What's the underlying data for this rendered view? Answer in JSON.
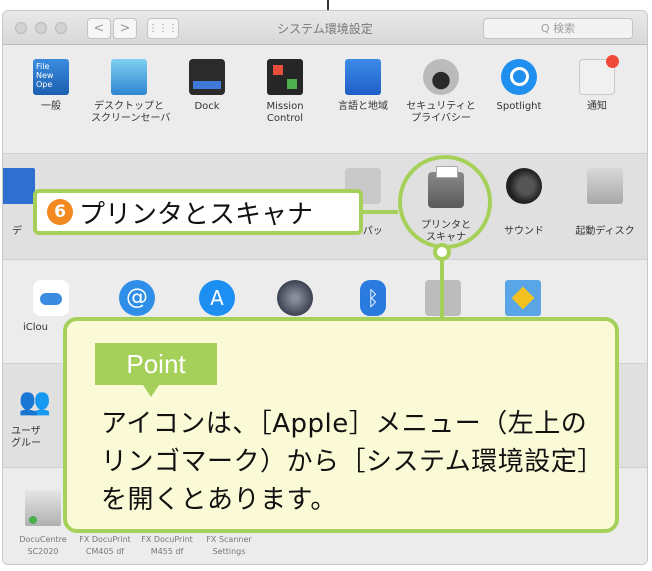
{
  "window": {
    "title": "システム環境設定",
    "search_placeholder": "Q 検索",
    "nav_back": "<",
    "nav_forward": ">",
    "grid_button": "⋮⋮⋮"
  },
  "row1": [
    {
      "label": "一般",
      "icon": "general-icon"
    },
    {
      "label": "デスクトップと\nスクリーンセーバ",
      "icon": "desktop-icon"
    },
    {
      "label": "Dock",
      "icon": "dock-icon"
    },
    {
      "label": "Mission\nControl",
      "icon": "mission-control-icon"
    },
    {
      "label": "言語と地域",
      "icon": "language-region-icon"
    },
    {
      "label": "セキュリティと\nプライバシー",
      "icon": "security-privacy-icon"
    },
    {
      "label": "Spotlight",
      "icon": "spotlight-icon"
    },
    {
      "label": "通知",
      "icon": "notifications-icon"
    }
  ],
  "row2": [
    {
      "label": "デ",
      "icon": "displays-icon"
    },
    {
      "label": "ックパッ",
      "icon": "trackpad-icon"
    },
    {
      "label": "プリンタと\nスキャナ",
      "icon": "printer-icon"
    },
    {
      "label": "サウンド",
      "icon": "sound-icon"
    },
    {
      "label": "起動ディスク",
      "icon": "startup-disk-icon"
    }
  ],
  "row3": [
    {
      "label": "iClou",
      "icon": "icloud-icon"
    },
    {
      "label": "",
      "icon": "internet-accounts-icon"
    },
    {
      "label": "",
      "icon": "app-store-icon"
    },
    {
      "label": "",
      "icon": "network-icon"
    },
    {
      "label": "",
      "icon": "bluetooth-icon"
    },
    {
      "label": "",
      "icon": "extensions-icon"
    },
    {
      "label": "",
      "icon": "sharing-icon"
    }
  ],
  "row4": [
    {
      "label": "ユーザ\nグルー",
      "icon": "users-groups-icon"
    }
  ],
  "row5_bottom": [
    "DocuCentre SC2020",
    "FX DocuPrint CM405 df",
    "FX DocuPrint M455 df",
    "FX Scanner Settings"
  ],
  "callout": {
    "step_number": "6",
    "step_text": "プリンタとスキャナ"
  },
  "point": {
    "tag": "Point",
    "text": "アイコンは、［Apple］メニュー（左上のリンゴマーク）から［システム環境設定］を開くとあります。"
  },
  "colors": {
    "accent_green": "#a5d15a",
    "step_orange": "#f28a1f",
    "point_bg": "#fbfad6"
  }
}
